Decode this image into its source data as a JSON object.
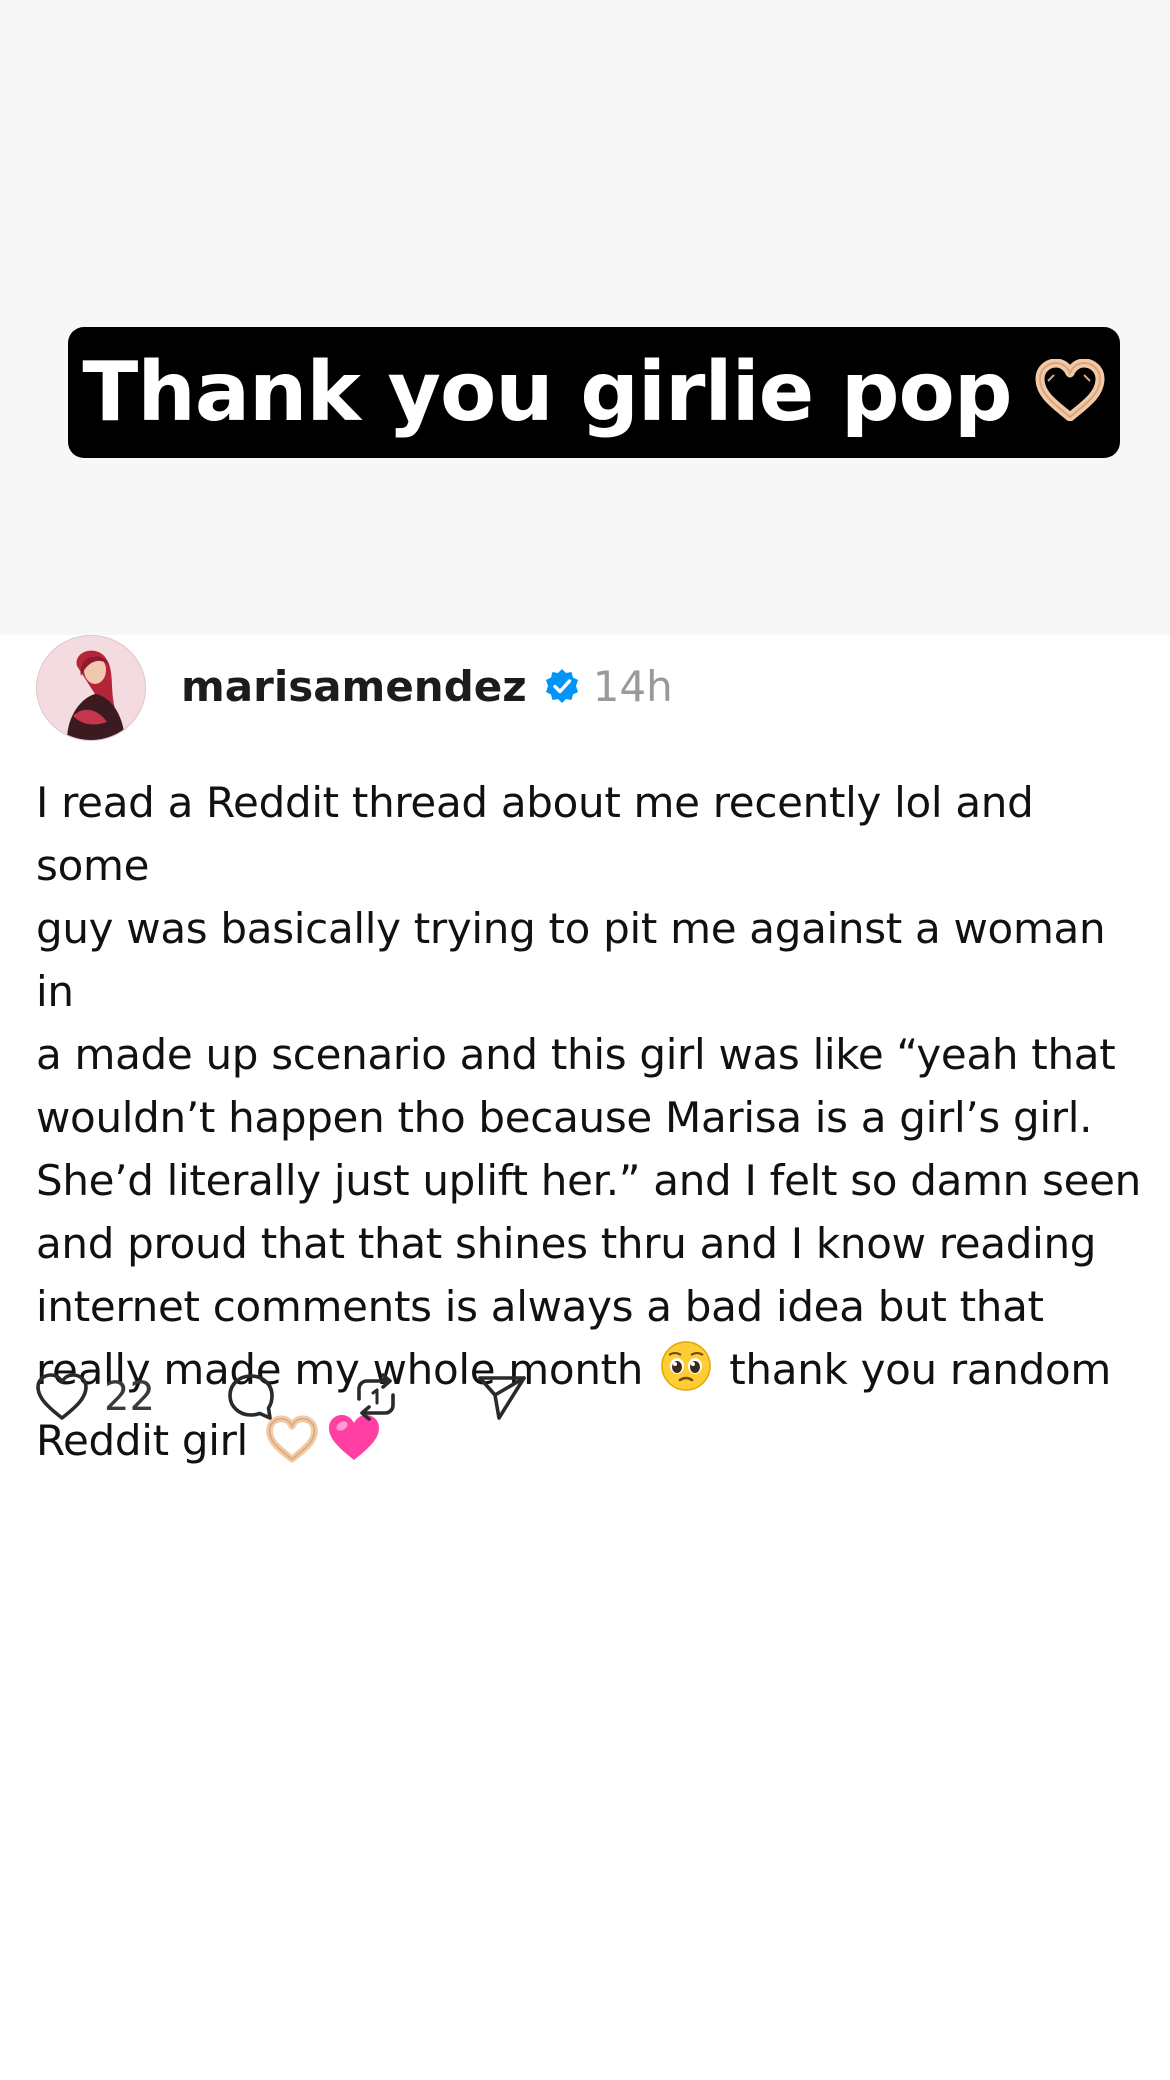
{
  "story": {
    "caption": "Thank you girlie pop",
    "caption_emoji": "heart-hands-emoji"
  },
  "post": {
    "username": "marisamendez",
    "verified": true,
    "timestamp": "14h",
    "body_lines": [
      "I read a Reddit thread about me recently lol and some",
      "guy was basically trying to pit me against a woman in",
      "a made up scenario and this girl was like “yeah that",
      "wouldn’t happen tho because Marisa is a girl’s girl.",
      "She’d literally just uplift her.” and I felt so damn seen",
      "and proud that that shines thru and I know reading",
      "internet comments is always a bad idea but that",
      "really made my whole month",
      "thank you random",
      "Reddit girl"
    ],
    "body_emojis": [
      "pleading-face-emoji",
      "heart-hands-emoji",
      "pink-heart-emoji"
    ],
    "actions": {
      "like_icon": "heart-icon",
      "like_count": "22",
      "comment_icon": "comment-icon",
      "repost_icon": "repost-icon",
      "share_icon": "send-icon"
    }
  },
  "colors": {
    "verified_badge": "#0095f6",
    "banner_bg": "#000000",
    "pink_heart": "#ff3fa4"
  }
}
